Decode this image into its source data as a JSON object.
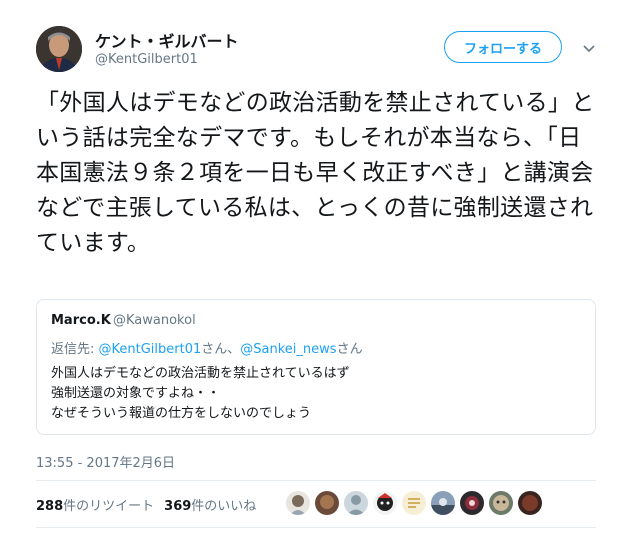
{
  "author": {
    "display_name": "ケント・ギルバート",
    "handle": "@KentGilbert01"
  },
  "follow_button": {
    "label": "フォローする"
  },
  "tweet": {
    "text": "「外国人はデモなどの政治活動を禁止されている」という話は完全なデマです。もしそれが本当なら、「日本国憲法９条２項を一日も早く改正すべき」と講演会などで主張している私は、とっくの昔に強制送還されています。"
  },
  "quote": {
    "display_name": "Marco.K",
    "handle": "@Kawanokol",
    "reply_prefix": "返信先: ",
    "reply_user_1": "@KentGilbert01",
    "reply_sep": "さん、",
    "reply_user_2": "@Sankei_news",
    "reply_suffix": "さん",
    "text": "外国人はデモなどの政治活動を禁止されているはず\n強制送還の対象ですよね・・\nなぜそういう報道の仕方をしないのでしょう"
  },
  "timestamp": "13:55 - 2017年2月6日",
  "stats": {
    "retweets_count": "288",
    "retweets_label": "件のリツイート",
    "likes_count": "369",
    "likes_label": "件のいいね"
  },
  "icons": {
    "caret": "chevron-down-icon"
  },
  "colors": {
    "accent": "#1da1f2",
    "text": "#14171a",
    "secondary": "#657786",
    "border": "#e1e8ed"
  }
}
